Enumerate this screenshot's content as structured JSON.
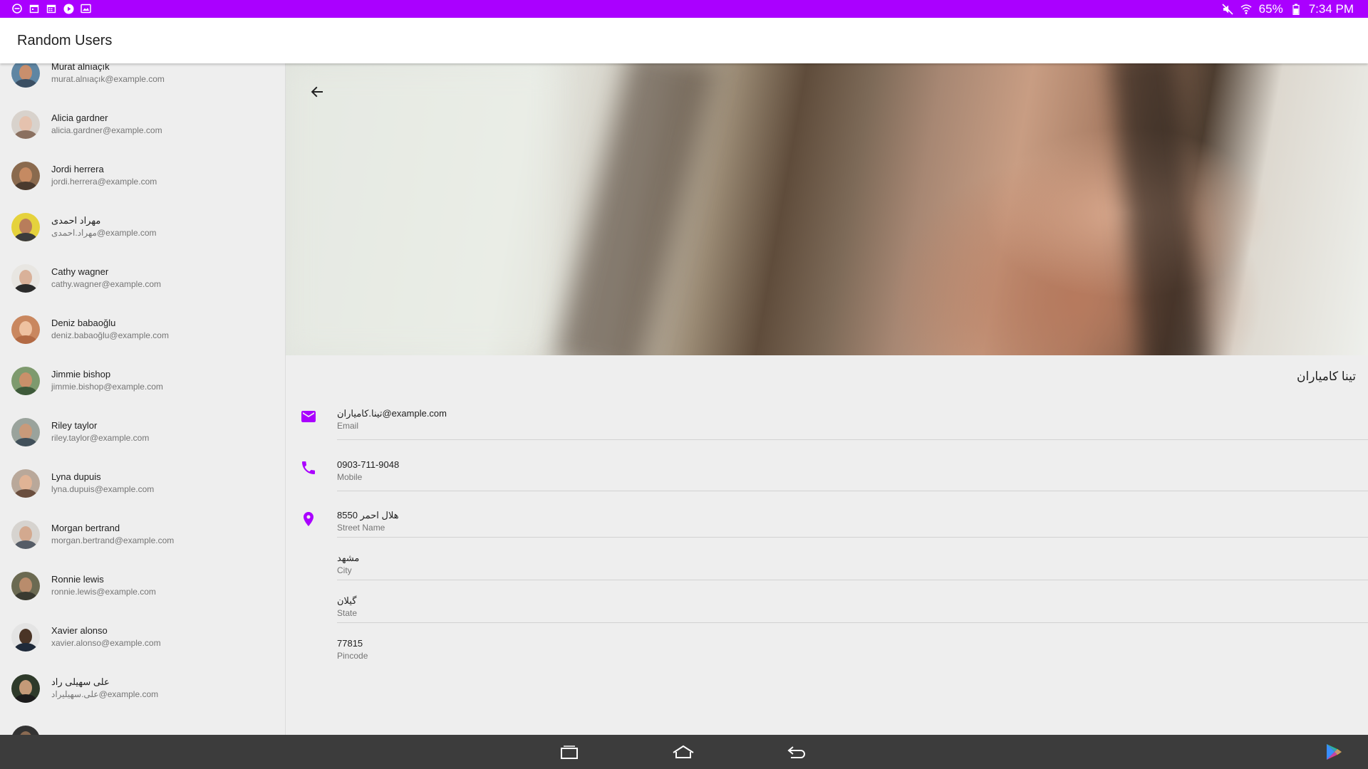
{
  "status_bar": {
    "battery": "65%",
    "time": "7:34 PM",
    "background": "#aa00ff",
    "left_icons": [
      "minus-circle-icon",
      "calendar-icon",
      "calendar-grid-icon",
      "play-icon",
      "gallery-icon"
    ],
    "right_icons": [
      "mute-icon",
      "wifi-icon",
      "battery-icon"
    ]
  },
  "app": {
    "title": "Random Users",
    "accent": "#aa00ff"
  },
  "users": [
    {
      "name": "Murat alnıaçık",
      "email": "murat.alnıaçık@example.com"
    },
    {
      "name": "Alicia gardner",
      "email": "alicia.gardner@example.com"
    },
    {
      "name": "Jordi herrera",
      "email": "jordi.herrera@example.com"
    },
    {
      "name": "مهراد احمدی",
      "email": "مهراد.احمدی@example.com"
    },
    {
      "name": "Cathy wagner",
      "email": "cathy.wagner@example.com"
    },
    {
      "name": "Deniz babaoğlu",
      "email": "deniz.babaoğlu@example.com"
    },
    {
      "name": "Jimmie bishop",
      "email": "jimmie.bishop@example.com"
    },
    {
      "name": "Riley taylor",
      "email": "riley.taylor@example.com"
    },
    {
      "name": "Lyna dupuis",
      "email": "lyna.dupuis@example.com"
    },
    {
      "name": "Morgan bertrand",
      "email": "morgan.bertrand@example.com"
    },
    {
      "name": "Ronnie lewis",
      "email": "ronnie.lewis@example.com"
    },
    {
      "name": "Xavier alonso",
      "email": "xavier.alonso@example.com"
    },
    {
      "name": "علی سهیلی راد",
      "email": "علی.سهیلیراد@example.com"
    }
  ],
  "detail": {
    "name": "تینا کامیاران",
    "email": {
      "value": "تینا.کامیاران@example.com",
      "label": "Email"
    },
    "mobile": {
      "value": "0903-711-9048",
      "label": "Mobile"
    },
    "street": {
      "value": "8550 هلال احمر",
      "label": "Street Name"
    },
    "city": {
      "value": "مشهد",
      "label": "City"
    },
    "state": {
      "value": "گیلان",
      "label": "State"
    },
    "pincode": {
      "value": "77815",
      "label": "Pincode"
    }
  },
  "nav_bar": {
    "buttons": [
      "recent-apps-icon",
      "home-icon",
      "back-icon"
    ],
    "corner_icon": "play-store-icon"
  }
}
